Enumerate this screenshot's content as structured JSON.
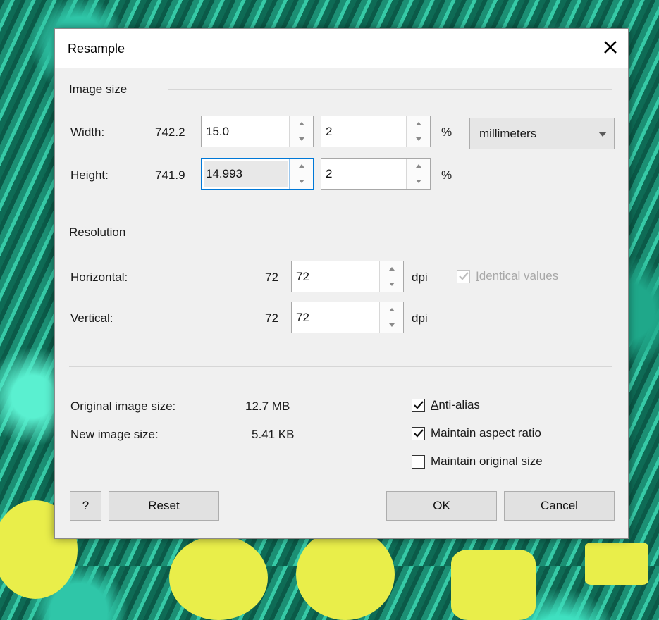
{
  "dialog": {
    "title": "Resample"
  },
  "image_size": {
    "section_label": "Image size",
    "width": {
      "label": "Width:",
      "original": "742.2",
      "value": "15.0",
      "percent": "2",
      "percent_unit": "%"
    },
    "height": {
      "label": "Height:",
      "original": "741.9",
      "value": "14.993",
      "percent": "2",
      "percent_unit": "%"
    },
    "units": {
      "selected": "millimeters"
    }
  },
  "resolution": {
    "section_label": "Resolution",
    "horizontal": {
      "label": "Horizontal:",
      "original": "72",
      "value": "72",
      "unit": "dpi"
    },
    "vertical": {
      "label": "Vertical:",
      "original": "72",
      "value": "72",
      "unit": "dpi"
    },
    "identical_values": {
      "label_prefix": "I",
      "label_rest": "dentical values",
      "checked": true,
      "enabled": false
    }
  },
  "summary": {
    "original_size_label": "Original image size:",
    "original_size_value": "12.7 MB",
    "new_size_label": "New image size:",
    "new_size_value": "5.41 KB"
  },
  "options": {
    "anti_alias": {
      "label_prefix": "A",
      "label_rest": "nti-alias",
      "checked": true
    },
    "maintain_aspect": {
      "label_prefix": "M",
      "label_rest": "aintain aspect ratio",
      "checked": true
    },
    "maintain_original": {
      "label_start": "Maintain original ",
      "label_underlined": "s",
      "label_end": "ize",
      "checked": false
    }
  },
  "buttons": {
    "help": "?",
    "reset": "Reset",
    "ok": "OK",
    "cancel": "Cancel"
  },
  "colors": {
    "focus_border": "#0078d7",
    "dialog_bg": "#f0f0f0",
    "background_accent": "#e9ee4a"
  },
  "icons": {
    "close": "close-icon",
    "spin_up": "chevron-up-icon",
    "spin_down": "chevron-down-icon",
    "dropdown": "dropdown-arrow-icon",
    "checkmark": "checkmark-icon"
  }
}
